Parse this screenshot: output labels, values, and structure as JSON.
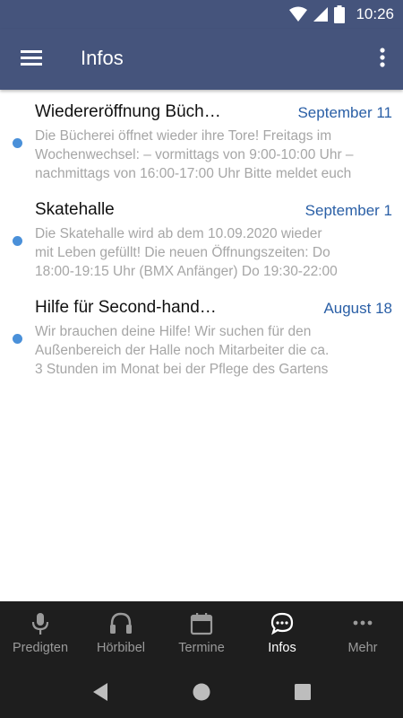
{
  "status_bar": {
    "time": "10:26"
  },
  "app_bar": {
    "title": "Infos"
  },
  "infos": [
    {
      "title": "Wiedereröffnung Büch…",
      "date": "September 11",
      "excerpt": "Die Bücherei öffnet wieder ihre Tore! Freitags im\nWochenwechsel: – vormittags von 9:00-10:00 Uhr –\nnachmittags von 16:00-17:00 Uhr Bitte meldet euch"
    },
    {
      "title": "Skatehalle",
      "date": "September 1",
      "excerpt": "Die Skatehalle wird ab dem 10.09.2020 wieder\nmit Leben gefüllt! Die neuen Öffnungszeiten: Do\n18:00-19:15 Uhr (BMX Anfänger) Do 19:30-22:00"
    },
    {
      "title": "Hilfe für Second-hand…",
      "date": "August 18",
      "excerpt": "Wir brauchen deine Hilfe! Wir suchen für den\nAußenbereich der Halle noch Mitarbeiter die ca.\n3 Stunden im Monat bei der Pflege des Gartens"
    }
  ],
  "bottom_nav": {
    "items": [
      {
        "label": "Predigten",
        "icon": "microphone-icon"
      },
      {
        "label": "Hörbibel",
        "icon": "headphones-icon"
      },
      {
        "label": "Termine",
        "icon": "calendar-icon"
      },
      {
        "label": "Infos",
        "icon": "chat-bubble-icon",
        "active": true
      },
      {
        "label": "Mehr",
        "icon": "more-horizontal-icon"
      }
    ]
  },
  "colors": {
    "app_bar": "#45547c",
    "accent_date": "#2a5fa6",
    "unread_dot": "#4a90d9",
    "bottom_nav_bg": "#1e1e1e"
  }
}
